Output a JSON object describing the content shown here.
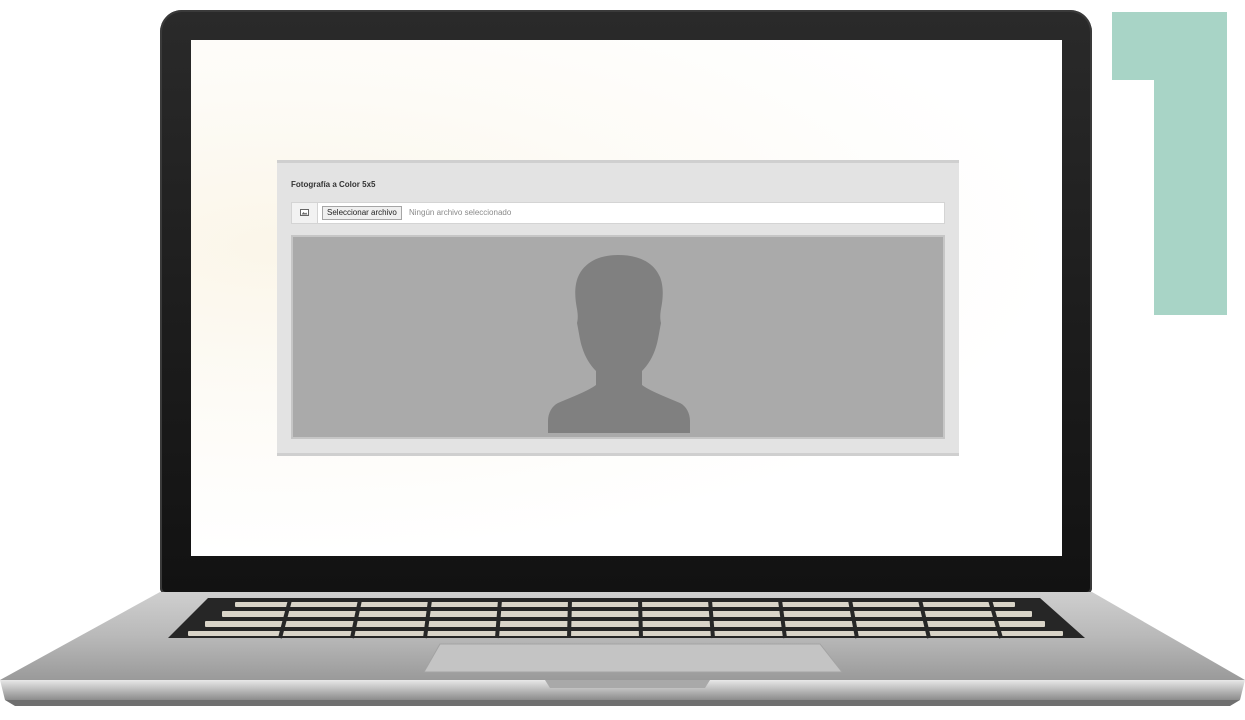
{
  "panel": {
    "title": "Fotografía a Color 5x5"
  },
  "file_input": {
    "icon": "image-icon",
    "button_label": "Seleccionar archivo",
    "status_text": "Ningún archivo seleccionado"
  },
  "photo_preview": {
    "icon": "person-silhouette-icon"
  },
  "decoration": {
    "numeral": "1",
    "numeral_color": "#a8d4c6"
  },
  "colors": {
    "panel_bg": "#e3e3e3",
    "photo_bg": "#aaaaaa",
    "silhouette": "#808080",
    "bezel": "#1b1b1b"
  }
}
